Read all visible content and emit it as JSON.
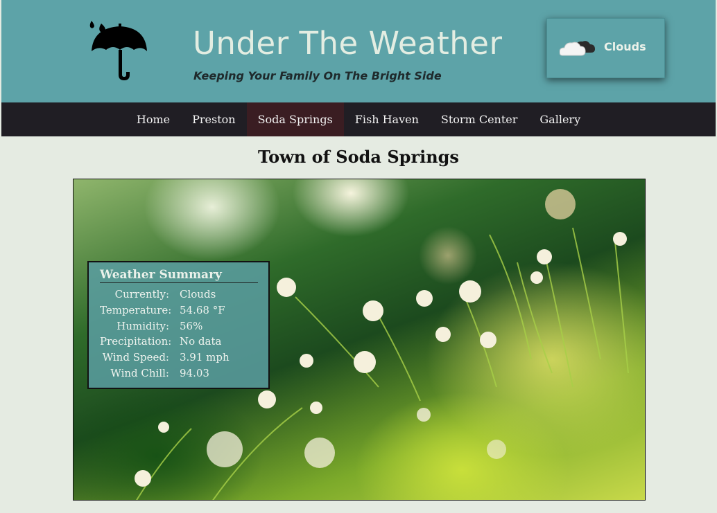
{
  "header": {
    "title": "Under The Weather",
    "tagline": "Keeping Your Family On The Bright Side",
    "logo_icon": "umbrella-rain-icon",
    "weather_badge": {
      "icon": "cloud-icon",
      "label": "Clouds"
    }
  },
  "nav": {
    "items": [
      {
        "label": "Home"
      },
      {
        "label": "Preston"
      },
      {
        "label": "Soda Springs",
        "active": true
      },
      {
        "label": "Fish Haven"
      },
      {
        "label": "Storm Center"
      },
      {
        "label": "Gallery"
      }
    ]
  },
  "main": {
    "title": "Town of Soda Springs",
    "summary": {
      "heading": "Weather Summary",
      "rows": [
        {
          "label": "Currently:",
          "value": "Clouds"
        },
        {
          "label": "Temperature:",
          "value": "54.68 °F"
        },
        {
          "label": "Humidity:",
          "value": "56%"
        },
        {
          "label": "Precipitation:",
          "value": "No data"
        },
        {
          "label": "Wind Speed:",
          "value": "3.91 mph"
        },
        {
          "label": "Wind Chill:",
          "value": "94.03"
        }
      ]
    }
  },
  "colors": {
    "header_bg": "#5da3a8",
    "nav_bg": "#201e24",
    "nav_active_bg": "#3a1d22",
    "page_bg": "#e5ebe2",
    "title_text": "#e3ede2"
  }
}
